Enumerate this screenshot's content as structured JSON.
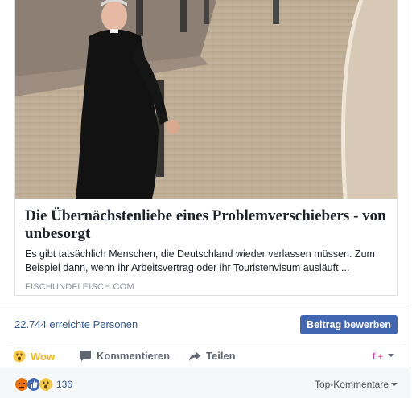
{
  "link_preview": {
    "title": "Die Übernächstenliebe eines Problemverschiebers - von unbesorgt",
    "description": "Es gibt tatsächlich Menschen, die Deutschland wieder verlassen müssen. Zum Beispiel dann, wenn ihr Arbeitsvertrag oder ihr Touristenvisum ausläuft ...",
    "domain": "FISCHUNDFLEISCH.COM",
    "image_alt": "priest-walking-cobblestone-street-photo"
  },
  "reach": {
    "text": "22.744 erreichte Personen",
    "boost_label": "Beitrag bewerben"
  },
  "actions": {
    "wow_label": "Wow",
    "comment_label": "Kommentieren",
    "share_label": "Teilen"
  },
  "summary": {
    "reactions": [
      "angry-icon",
      "like-icon",
      "wow-icon"
    ],
    "count": "136",
    "sort_label": "Top-Kommentare"
  },
  "colors": {
    "link_blue": "#365899",
    "button_blue": "#4267b2",
    "wow_yellow": "#f0ba15",
    "gray_text": "#606770"
  }
}
